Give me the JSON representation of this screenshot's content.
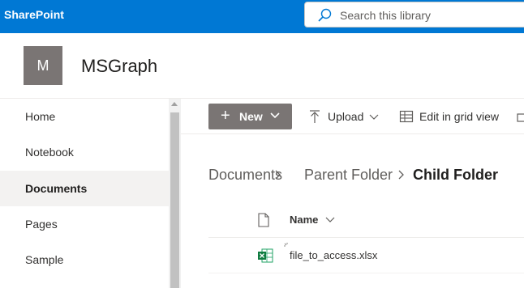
{
  "suite_bar": {
    "brand": "SharePoint",
    "search_placeholder": "Search this library",
    "accent_color": "#0078d4"
  },
  "site": {
    "logo_letter": "M",
    "title": "MSGraph",
    "logo_color": "#7a7574"
  },
  "left_nav": {
    "items": [
      {
        "label": "Home",
        "selected": false
      },
      {
        "label": "Notebook",
        "selected": false
      },
      {
        "label": "Documents",
        "selected": true
      },
      {
        "label": "Pages",
        "selected": false
      },
      {
        "label": "Sample",
        "selected": false
      }
    ]
  },
  "command_bar": {
    "new_label": "New",
    "upload_label": "Upload",
    "edit_grid_label": "Edit in grid view"
  },
  "breadcrumb": {
    "items": [
      "Documents",
      "Parent Folder"
    ],
    "current": "Child Folder"
  },
  "list": {
    "name_column": "Name",
    "files": [
      {
        "name": "file_to_access.xlsx",
        "icon": "excel-icon"
      }
    ]
  }
}
